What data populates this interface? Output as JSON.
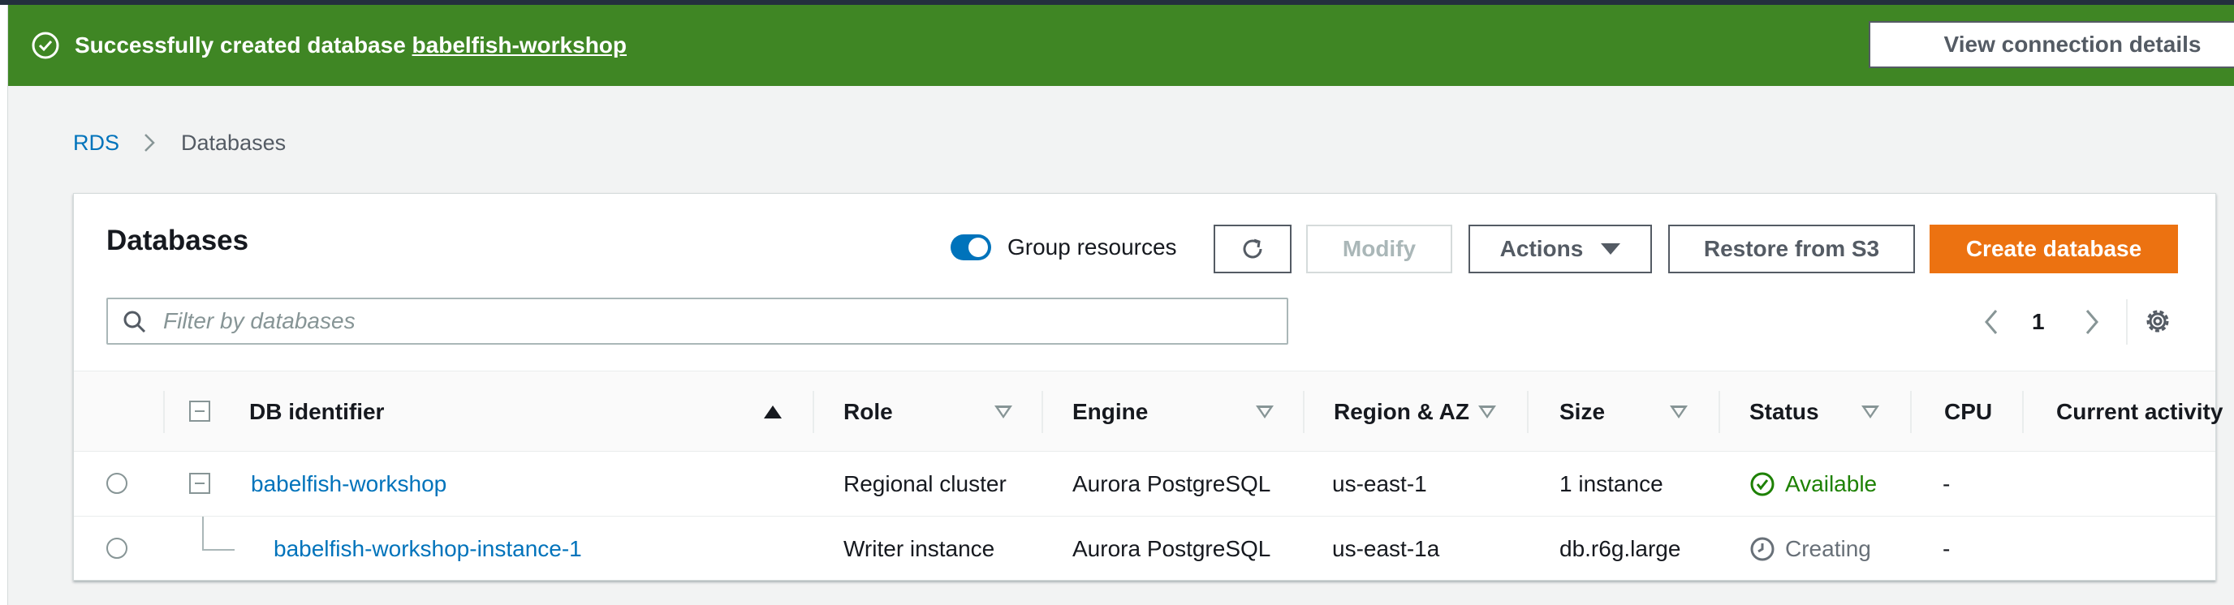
{
  "flash": {
    "message_prefix": "Successfully created database",
    "database_link": "babelfish-workshop",
    "view_button": "View connection details",
    "color": "#3f8624"
  },
  "breadcrumb": {
    "root": "RDS",
    "current": "Databases"
  },
  "panel": {
    "title": "Databases",
    "group_resources_label": "Group resources",
    "group_resources_enabled": true,
    "buttons": {
      "modify": "Modify",
      "actions": "Actions",
      "restore": "Restore from S3",
      "create": "Create database"
    },
    "accent_color": "#ec7211",
    "filter_placeholder": "Filter by databases",
    "page_number": "1"
  },
  "table": {
    "columns": [
      "DB identifier",
      "Role",
      "Engine",
      "Region & AZ",
      "Size",
      "Status",
      "CPU",
      "Current activity"
    ],
    "sorted_column": "DB identifier",
    "rows": [
      {
        "identifier": "babelfish-workshop",
        "role": "Regional cluster",
        "engine": "Aurora PostgreSQL",
        "region": "us-east-1",
        "size": "1 instance",
        "status": "Available",
        "cpu": "-"
      },
      {
        "identifier": "babelfish-workshop-instance-1",
        "role": "Writer instance",
        "engine": "Aurora PostgreSQL",
        "region": "us-east-1a",
        "size": "db.r6g.large",
        "status": "Creating",
        "cpu": "-"
      }
    ]
  }
}
